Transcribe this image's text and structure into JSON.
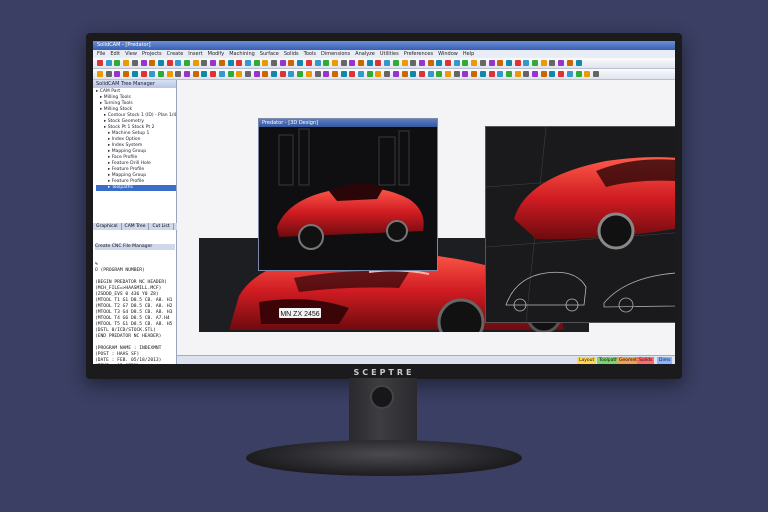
{
  "window": {
    "title": "SolidCAM - [Predator]"
  },
  "menu": {
    "items": [
      "File",
      "Edit",
      "View",
      "Projects",
      "Create",
      "Insert",
      "Modify",
      "Machining",
      "Surface",
      "Solids",
      "Tools",
      "Dimensions",
      "Analyze",
      "Utilities",
      "Preferences",
      "Window",
      "Help"
    ]
  },
  "left_panel": {
    "title": "SolidCAM Tree Manager",
    "tree": [
      "CAM Part",
      "Milling Tools",
      "Turning Tools",
      "Milling Stock",
      "Contour Stock 1 (ID) - Plan 1/4",
      "Stock Geometry",
      "Stock Pt 1 Stock Pt 2",
      "Machine Setup 1",
      "Index Option",
      "Index System",
      "Mapping Group",
      "Face Profile",
      "Feature Drill Hole",
      "Feature Profile",
      "Mapping Group",
      "Feature Profile",
      "Toolpaths"
    ],
    "tabs": [
      "Graphical",
      "CAM Tree",
      "Cut List"
    ],
    "nc_list_title": "Create CNC File Manager",
    "nc_lines": [
      "%",
      "O (PROGRAM NUMBER)",
      "",
      "(BEGIN PREDATOR NC HEADER)",
      "(MCH_FILE=>HAASMILL.MCF)",
      "(ZSDDD_EVS 0 436 Y0 Z8)",
      "(MTOOL T1 G1 D8.5 CB. A8. H1",
      "(MTOOL T2 G7 D8.5 CB. A8. H2",
      "(MTOOL T3 G4 D8.5 CB. A8. H3",
      "(MTOOL T4 G6 D8.5 CB. A7.H4",
      "(MTOOL T5 G1 D8.5 CB. A8. H5",
      "(DSTL 0/ICD/STOCK.STL)",
      "(END PREDATOR NC HEADER)",
      "",
      "(PROGRAM NAME : INDEXMNT",
      "(POST : HAAS SF)",
      "(DATE : FEB. 05/18/2013)",
      "(TIME : 03:07PM)",
      "",
      "G00 G17 G40 G49 G80 G20 G9",
      "",
      "(FIRST CUT - FIRST TOOL)",
      "(OPR 1 : CONTOUR)",
      "(FEATURE PROFILE)",
      "",
      "(TOOL #1 0.5 ENDMILL ROUGH",
      "T1 M06",
      "A0.",
      "G00 G54 X0.0897 Y1.3897 S58",
      "G43 H1 D1 Z0.6 M08",
      "M98 P5 (SUBPROGRAM CALL)",
      "G01 Z-0.2 F50."
    ]
  },
  "viewport_window": {
    "title": "Predator - [3D Design]"
  },
  "car_plate": "MN ZX 2456",
  "status_tabs": [
    "Layout",
    "Toolpaths",
    "Geometry",
    "Solids",
    "Dims"
  ],
  "monitor_brand": "SCEPTRE",
  "colors": {
    "desktop_bg": "#3a3f63",
    "car_red": "#d7242a",
    "title_blue": "#3a5fb3"
  }
}
